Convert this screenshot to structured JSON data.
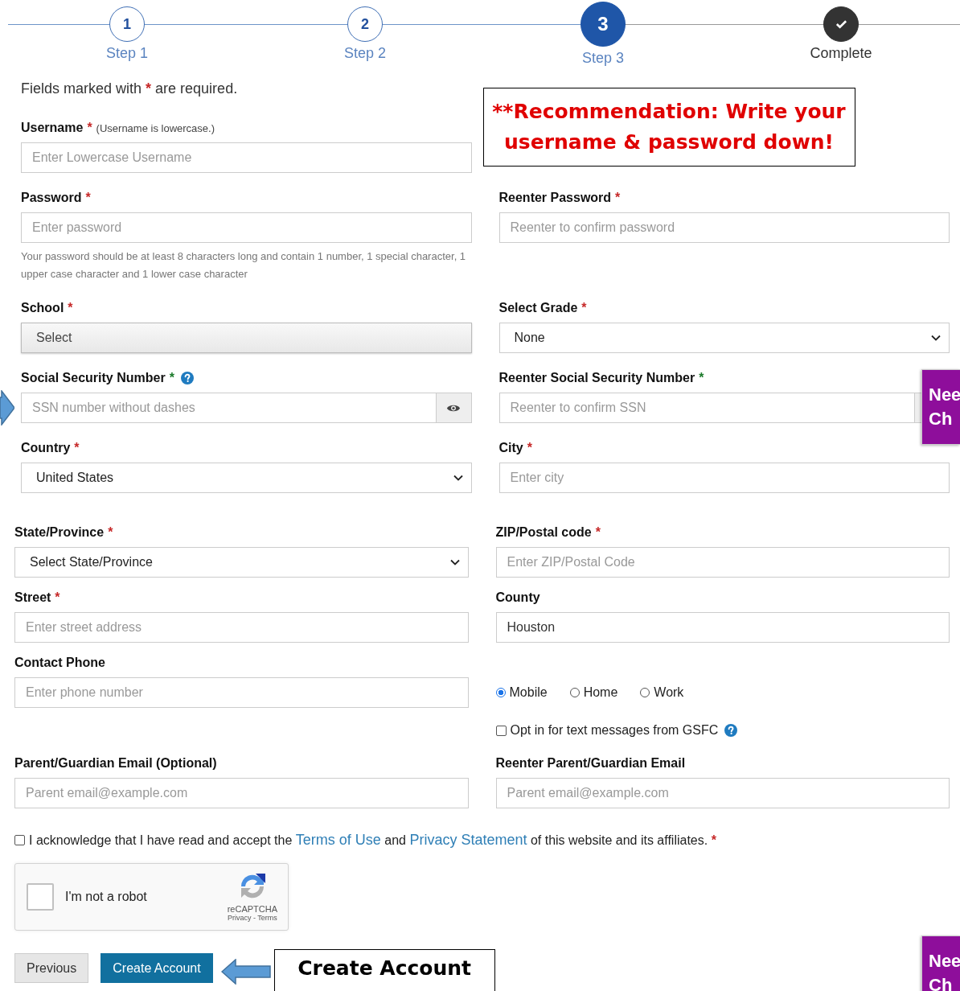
{
  "steps": [
    {
      "kind": "number",
      "number": "1",
      "label": "Step 1",
      "selected": false
    },
    {
      "kind": "number",
      "number": "2",
      "label": "Step 2",
      "selected": false
    },
    {
      "kind": "number",
      "number": "3",
      "label": "Step 3",
      "selected": true
    },
    {
      "kind": "check",
      "label": "Complete",
      "selected": false
    }
  ],
  "sections": [
    {
      "items": [
        {
          "kind": "note",
          "text_before": "Fields marked with",
          "star": "*",
          "text_after": "are required."
        },
        {
          "kind": "text",
          "label": "Username",
          "star": "*",
          "aside": "(Username is lowercase.)",
          "placeholder": "Enter Lowercase Username"
        },
        {
          "kind": "callout",
          "text": "**Recommendation: Write your username & password down!"
        },
        {
          "kind": "text",
          "label": "Password",
          "star": "*",
          "placeholder": "Enter password",
          "hint": "Your password should be at least 8 characters long and contain 1 number, 1 special character, 1 upper case character and 1 lower case character"
        },
        {
          "kind": "text",
          "label": "Reenter Password",
          "star": "*",
          "placeholder": "Reenter to confirm password"
        },
        {
          "kind": "school-select",
          "label": "School",
          "star": "*",
          "value": "Select"
        },
        {
          "kind": "select",
          "label": "Select Grade",
          "star": "*",
          "value": "None"
        },
        {
          "kind": "ssn",
          "label": "Social Security Number",
          "star": "*",
          "color": "#1b7a2a",
          "help_icon": true,
          "reveal_icon": true,
          "placeholder": "SSN number without dashes"
        },
        {
          "kind": "ssn",
          "label": "Reenter Social Security Number",
          "star": "*",
          "color": "#1b7a2a",
          "help_icon": false,
          "reveal_icon": false,
          "placeholder": "Reenter to confirm SSN"
        },
        {
          "kind": "select",
          "label": "Country",
          "star": "*",
          "value": "United States"
        },
        {
          "kind": "text",
          "label": "City",
          "star": "*",
          "placeholder": "Enter city"
        }
      ]
    },
    {
      "items": [
        {
          "kind": "select",
          "label": "State/Province",
          "star": "*",
          "value": "Select State/Province"
        },
        {
          "kind": "text",
          "label": "ZIP/Postal code",
          "star": "*",
          "placeholder": "Enter ZIP/Postal Code"
        },
        {
          "kind": "text",
          "label": "Street",
          "star": "*",
          "placeholder": "Enter street address"
        },
        {
          "kind": "text",
          "label": "County",
          "value": "Houston"
        },
        {
          "kind": "text",
          "label": "Contact Phone",
          "placeholder": "Enter phone number"
        },
        {
          "kind": "radios",
          "options": [
            {
              "label": "Mobile",
              "selected": true
            },
            {
              "label": "Home",
              "selected": false
            },
            {
              "label": "Work",
              "selected": false
            }
          ]
        },
        {
          "kind": "checkbox",
          "label": "Opt in for text messages from GSFC",
          "checked": false,
          "help_icon": true
        },
        {
          "kind": "text",
          "label": "Parent/Guardian Email (Optional)",
          "placeholder": "Parent email@example.com"
        },
        {
          "kind": "text",
          "label": "Reenter Parent/Guardian Email",
          "placeholder": "Parent email@example.com"
        }
      ]
    }
  ],
  "terms": {
    "checked": false,
    "text_before": "I acknowledge that I have read and accept the",
    "link_1": "Terms of Use",
    "text_middle": "and",
    "link_2": "Privacy Statement",
    "text_after": "of this website and its affiliates.",
    "star": "*"
  },
  "captcha": {
    "checked": false,
    "label": "I'm not a robot",
    "brand": "reCAPTCHA",
    "privacy": "Privacy",
    "separator": "-",
    "terms": "Terms"
  },
  "buttons": [
    {
      "kind": "secondary",
      "label": "Previous"
    },
    {
      "kind": "primary",
      "label": "Create Account"
    }
  ],
  "annotation": "Create Account",
  "side_tabs": [
    {
      "text": "Nee Ch"
    },
    {
      "text": "Nee Ch"
    }
  ]
}
